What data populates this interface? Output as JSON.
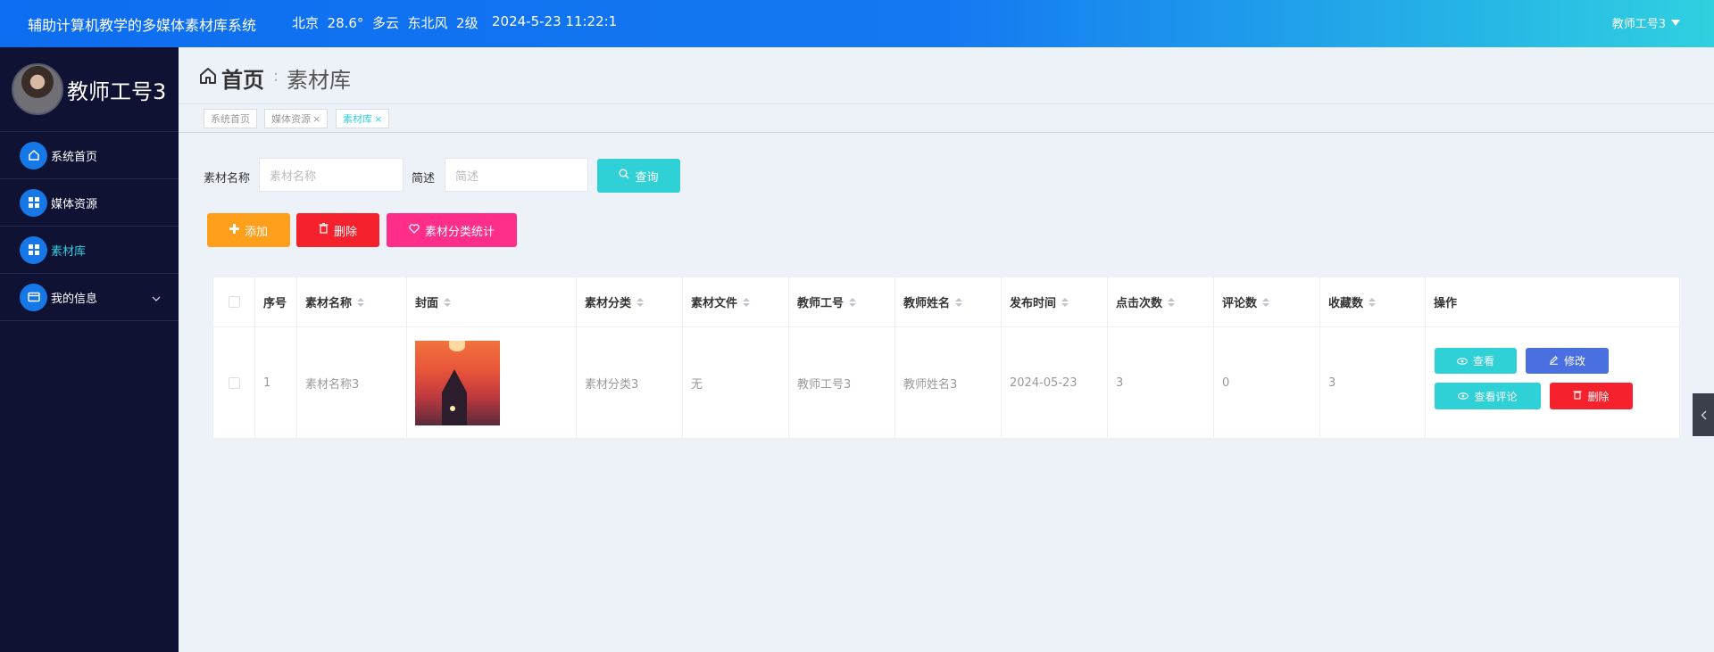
{
  "topbar": {
    "system_title": "辅助计算机教学的多媒体素材库系统",
    "weather": "北京  28.6°  多云  东北风  2级",
    "datetime": "2024-5-23 11:22:1",
    "user_name": "教师工号3"
  },
  "sidebar": {
    "profile_name": "教师工号3",
    "items": [
      {
        "label": "系统首页",
        "icon": "home-icon"
      },
      {
        "label": "媒体资源",
        "icon": "grid-icon"
      },
      {
        "label": "素材库",
        "icon": "grid-icon"
      },
      {
        "label": "我的信息",
        "icon": "card-icon"
      }
    ]
  },
  "breadcrumb": {
    "home": "首页",
    "separator": ":",
    "current": "素材库"
  },
  "tags": [
    {
      "label": "系统首页",
      "closable": ""
    },
    {
      "label": "媒体资源",
      "closable": "×"
    },
    {
      "label": "素材库",
      "closable": "×"
    }
  ],
  "search": {
    "name_label": "素材名称",
    "name_placeholder": "素材名称",
    "desc_label": "简述",
    "desc_placeholder": "简述",
    "query_button": "查询"
  },
  "actions": {
    "add": "添加",
    "delete": "删除",
    "stats": "素材分类统计"
  },
  "table": {
    "columns": [
      "序号",
      "素材名称",
      "封面",
      "素材分类",
      "素材文件",
      "教师工号",
      "教师姓名",
      "发布时间",
      "点击次数",
      "评论数",
      "收藏数",
      "操作"
    ],
    "rows": [
      {
        "index": "1",
        "name": "素材名称3",
        "category": "素材分类3",
        "file": "无",
        "teacher_id": "教师工号3",
        "teacher_name": "教师姓名3",
        "publish_time": "2024-05-23",
        "clicks": "3",
        "comments": "0",
        "favorites": "3",
        "ops": {
          "view": "查看",
          "edit": "修改",
          "view_comments": "查看评论",
          "delete": "删除"
        }
      }
    ]
  },
  "colors": {
    "topbar_start": "#0d6df0",
    "topbar_end": "#2fd0e0",
    "sidebar_bg": "#0f1233",
    "accent_cyan": "#2fd0e0",
    "add_orange": "#ff9f1c",
    "delete_red": "#f5222d",
    "stats_pink": "#ff2e8a",
    "edit_blue": "#4a6fe0"
  }
}
